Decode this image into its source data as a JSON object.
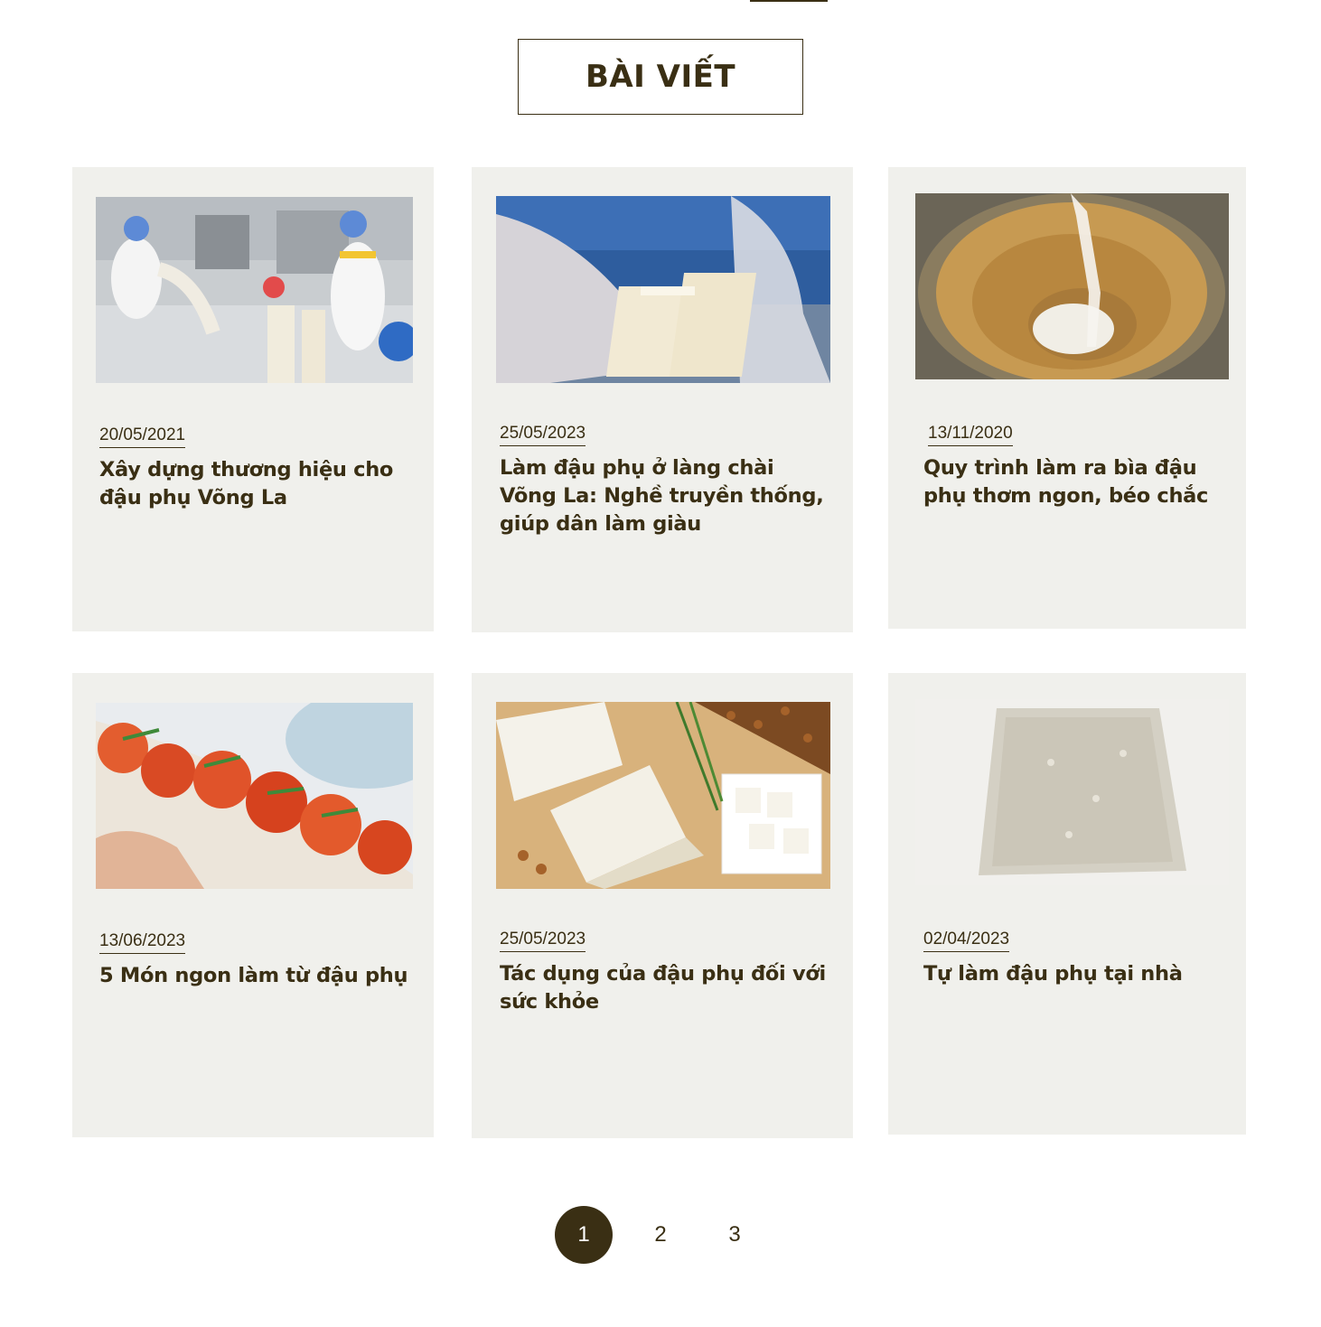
{
  "section": {
    "title": "BÀI VIẾT"
  },
  "posts": [
    {
      "date": "20/05/2021",
      "title": "Xây dựng thương hiệu cho đậu phụ Võng La",
      "image": "tofu-factory-workers-photo"
    },
    {
      "date": "25/05/2023",
      "title": "Làm đậu phụ ở làng chài Võng La: Nghề truyền thống, giúp dân làm giàu",
      "image": "gloved-hands-holding-tofu-photo"
    },
    {
      "date": "13/11/2020",
      "title": "Quy trình làm ra bìa đậu phụ thơm ngon, béo chắc",
      "image": "basket-soy-milk-pouring-photo"
    },
    {
      "date": "13/06/2023",
      "title": "5 Món ngon làm từ đậu phụ",
      "image": "tofu-tomato-dish-photo"
    },
    {
      "date": "25/05/2023",
      "title": "Tác dụng của đậu phụ đối với sức khỏe",
      "image": "tofu-blocks-soybeans-photo"
    },
    {
      "date": "02/04/2023",
      "title": "Tự làm đậu phụ tại nhà",
      "image": "tofu-curd-in-cloth-photo"
    }
  ],
  "pagination": {
    "pages": [
      "1",
      "2",
      "3"
    ],
    "current": "1"
  },
  "colors": {
    "primary": "#3a2f14",
    "card_bg": "#f0f0ec"
  }
}
